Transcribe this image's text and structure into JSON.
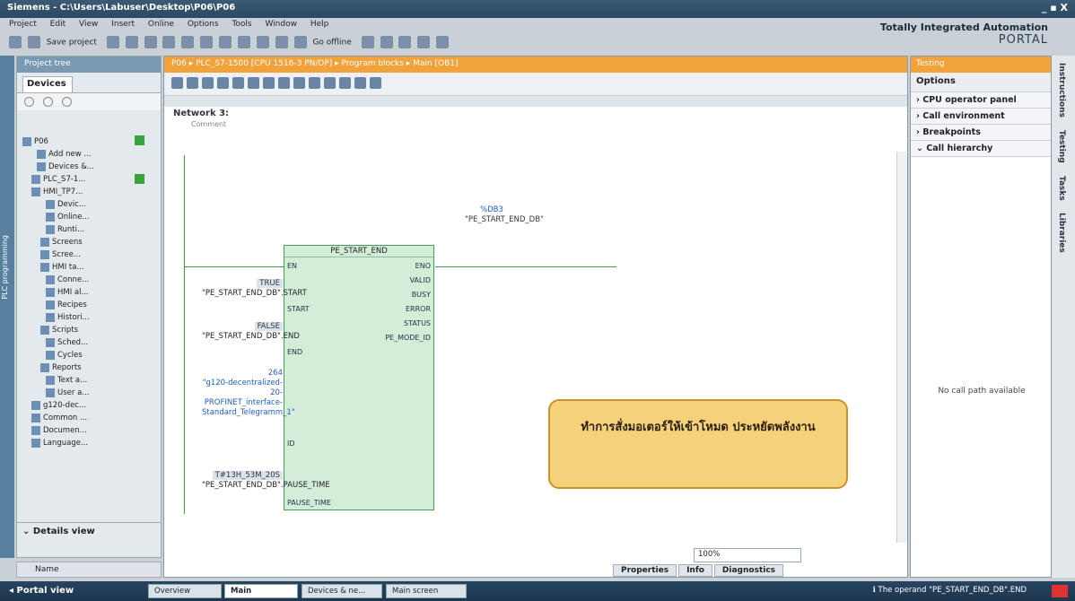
{
  "window": {
    "title": "Siemens - C:\\Users\\Labuser\\Desktop\\P06\\P06",
    "controls": "_ ▪ X"
  },
  "menu": [
    "Project",
    "Edit",
    "View",
    "Insert",
    "Online",
    "Options",
    "Tools",
    "Window",
    "Help"
  ],
  "toolbar": {
    "save_label": "Save project",
    "go_offline": "Go offline"
  },
  "brand": {
    "line1": "Totally Integrated Automation",
    "line2": "PORTAL"
  },
  "left_vtab": "PLC programming",
  "project_tree": {
    "header": "Project tree",
    "tab": "Devices",
    "items": [
      {
        "label": "P06",
        "check": true
      },
      {
        "label": "Add new ..."
      },
      {
        "label": "Devices &..."
      },
      {
        "label": "PLC_S7-1...",
        "check": true
      },
      {
        "label": "HMI_TP7..."
      },
      {
        "label": "Devic..."
      },
      {
        "label": "Online..."
      },
      {
        "label": "Runti..."
      },
      {
        "label": "Screens"
      },
      {
        "label": "Scree..."
      },
      {
        "label": "HMI ta..."
      },
      {
        "label": "Conne..."
      },
      {
        "label": "HMI al..."
      },
      {
        "label": "Recipes"
      },
      {
        "label": "Histori..."
      },
      {
        "label": "Scripts"
      },
      {
        "label": "Sched..."
      },
      {
        "label": "Cycles"
      },
      {
        "label": "Reports"
      },
      {
        "label": "Text a..."
      },
      {
        "label": "User a..."
      },
      {
        "label": "g120-dec..."
      },
      {
        "label": "Common ..."
      },
      {
        "label": "Documen..."
      },
      {
        "label": "Language..."
      }
    ],
    "details_view": "Details view",
    "name_col": "Name"
  },
  "editor": {
    "breadcrumb": "P06 ▸ PLC_S7-1500 [CPU 1516-3 PN/DP] ▸ Program blocks ▸ Main [OB1]",
    "network": "Network 3:",
    "comment": "Comment",
    "db_number": "%DB3",
    "db_name": "\"PE_START_END_DB\"",
    "block_name": "PE_START_END",
    "inputs": {
      "en": "EN",
      "start": "START",
      "end": "END",
      "id": "ID",
      "pause": "PAUSE_TIME"
    },
    "outputs": {
      "eno": "ENO",
      "valid": "VALID",
      "busy": "BUSY",
      "error": "ERROR",
      "status": "STATUS",
      "mode": "PE_MODE_ID"
    },
    "start_val": "TRUE",
    "start_op": "\"PE_START_END_DB\".START",
    "end_val": "FALSE",
    "end_op": "\"PE_START_END_DB\".END",
    "id_val": "264",
    "id_op": "\"g120-decentralized-20-PROFINET_interface-Standard_Telegramm_1\"",
    "pause_val": "T#13H_53M_20S",
    "pause_op": "\"PE_START_END_DB\".PAUSE_TIME",
    "callout": "ทำการสั่งมอเตอร์ให้เข้าโหมด ประหยัดพลังงาน",
    "zoom": "100%",
    "tabs": [
      "Properties",
      "Info",
      "Diagnostics"
    ]
  },
  "testing": {
    "header": "Testing",
    "options": "Options",
    "sections": [
      "CPU operator panel",
      "Call environment",
      "Breakpoints",
      "Call hierarchy"
    ],
    "no_call": "No call path available"
  },
  "right_vtabs": [
    "Instructions",
    "Testing",
    "Tasks",
    "Libraries"
  ],
  "statusbar": {
    "portal_view": "Portal view",
    "tabs": [
      "Overview",
      "Main",
      "Devices & ne...",
      "Main screen"
    ],
    "message": "The operand \"PE_START_END_DB\".END"
  }
}
